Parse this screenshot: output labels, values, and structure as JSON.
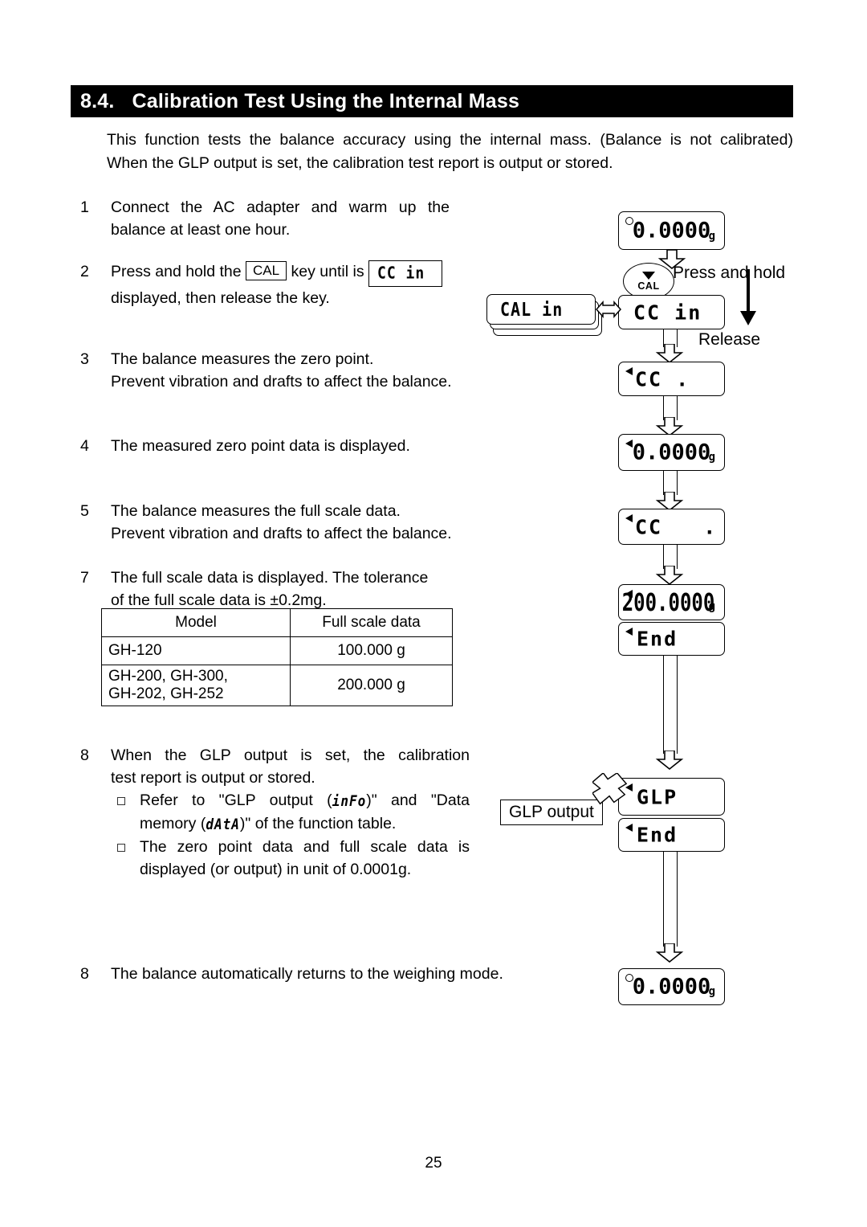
{
  "section": {
    "number": "8.4.",
    "title": "Calibration Test Using the Internal Mass"
  },
  "intro": {
    "line1": "This function tests the balance accuracy using the internal mass. (Balance is not calibrated)",
    "line2": "When the GLP output is set, the calibration test report is output or stored."
  },
  "steps": {
    "s1": {
      "num": "1",
      "line1": "Connect the AC adapter and warm up the",
      "line2": "balance at least one hour."
    },
    "s2": {
      "num": "2",
      "part1": "Press and hold the",
      "key": "CAL",
      "part2": "key until is",
      "token": "CC in",
      "line2": "displayed, then release the key."
    },
    "s3": {
      "num": "3",
      "line1": "The balance measures the zero point.",
      "line2": "Prevent vibration and drafts to affect the balance."
    },
    "s4": {
      "num": "4",
      "line1": "The measured zero point data is displayed."
    },
    "s5": {
      "num": "5",
      "line1": "The balance measures the full scale data.",
      "line2": "Prevent vibration and drafts to affect the balance."
    },
    "s7": {
      "num": "7",
      "line1": "The full scale data is displayed. The tolerance",
      "line2": "of the full scale data is ±0.2mg."
    },
    "s8": {
      "num": "8",
      "line1": "When the GLP output is set, the calibration",
      "line2": "test report is output or stored.",
      "bullet1_a": "Refer to \"GLP output (",
      "bullet1_seg1": "inFo",
      "bullet1_b": ")\" and \"Data",
      "bullet1_c": "memory (",
      "bullet1_seg2": "dAtA",
      "bullet1_d": ")\" of the function table.",
      "bullet2_a": "The zero point data and full scale data is",
      "bullet2_b": "displayed (or output) in unit of 0.0001g."
    },
    "s8b": {
      "num": "8",
      "line1": "The balance automatically returns to the weighing mode."
    }
  },
  "table": {
    "headers": [
      "Model",
      "Full scale data"
    ],
    "rows": [
      {
        "model": "GH-120",
        "data": "100.000 g"
      },
      {
        "model_line1": "GH-200, GH-300,",
        "model_line2": "GH-202, GH-252",
        "data": "200.000 g"
      }
    ]
  },
  "diagram": {
    "stacked_display": {
      "value": "CAL in"
    },
    "cal_key": {
      "label": "CAL"
    },
    "press_hold_label": "Press and hold",
    "release_label": "Release",
    "glp_output_label": "GLP output",
    "displays": [
      {
        "id": "d1",
        "value": "0.0000",
        "unit": "g",
        "marker": "circle"
      },
      {
        "id": "d2",
        "value": "CC in",
        "unit": "",
        "marker": "none"
      },
      {
        "id": "d3",
        "value": "CC .",
        "unit": "",
        "marker": "triangle"
      },
      {
        "id": "d4",
        "value": "0.0000",
        "unit": "g",
        "marker": "triangle"
      },
      {
        "id": "d5",
        "value": "CC   .",
        "unit": "",
        "marker": "triangle"
      },
      {
        "id": "d6",
        "value": "200.0000",
        "unit": "g",
        "marker": "triangle"
      },
      {
        "id": "d7",
        "value": "End",
        "unit": "",
        "marker": "triangle"
      },
      {
        "id": "d8",
        "value": "GLP",
        "unit": "",
        "marker": "triangle"
      },
      {
        "id": "d9",
        "value": "End",
        "unit": "",
        "marker": "triangle"
      },
      {
        "id": "d10",
        "value": "0.0000",
        "unit": "g",
        "marker": "circle"
      }
    ]
  },
  "page_number": "25",
  "colors": {
    "header_bg": "#000000",
    "header_fg": "#ffffff",
    "line": "#000000"
  }
}
